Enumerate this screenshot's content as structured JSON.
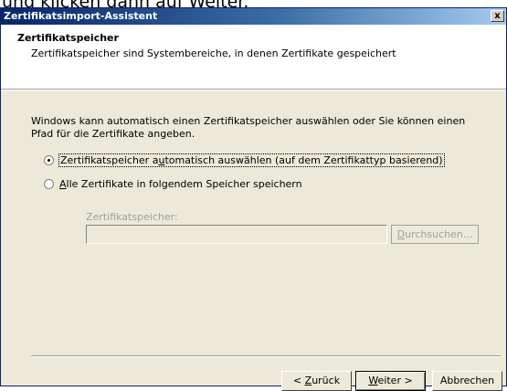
{
  "page_caption": "und klicken dann auf Weiter.",
  "window": {
    "title": "Zertifikatsimport-Assistent",
    "close_glyph": "x"
  },
  "header": {
    "title": "Zertifikatspeicher",
    "subtitle": "Zertifikatspeicher sind Systembereiche, in denen Zertifikate gespeichert"
  },
  "body": {
    "intro": "Windows kann automatisch einen Zertifikatspeicher auswählen oder Sie können einen Pfad für die Zertifikate angeben.",
    "options": [
      {
        "label_a": "Zertifikatspeicher a",
        "underline": "u",
        "label_b": "tomatisch auswählen (auf dem Zertifikattyp basierend)",
        "selected": true
      },
      {
        "label_a": "",
        "underline": "A",
        "label_b": "lle Zertifikate in folgendem Speicher speichern",
        "selected": false
      }
    ],
    "store": {
      "label": "Zertifikatspeicher:",
      "value": "",
      "browse_underline": "D",
      "browse_rest": "urchsuchen..."
    }
  },
  "footer": {
    "back": {
      "prefix": "< ",
      "underline": "Z",
      "rest": "urück"
    },
    "next": {
      "underline": "W",
      "rest": "eiter >"
    },
    "cancel": "Abbrechen"
  }
}
